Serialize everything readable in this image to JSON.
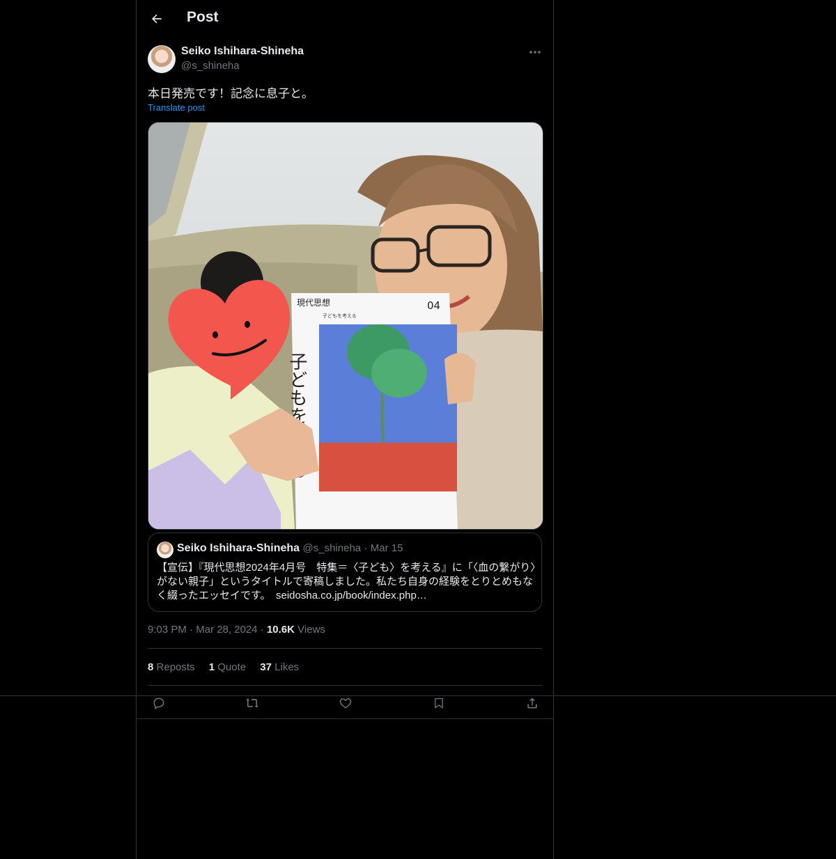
{
  "header": {
    "title": "Post",
    "back_icon": "arrow-left-icon"
  },
  "author": {
    "display_name": "Seiko Ishihara-Shineha",
    "handle": "@s_shineha"
  },
  "post": {
    "text": "本日発売です！記念に息子と。",
    "translate_label": "Translate post",
    "image": {
      "book_title_small": "現代思想",
      "book_issue": "04",
      "book_cover_vertical": "子どもを考える",
      "book_subtitle": "子どもを考える"
    }
  },
  "quoted_post": {
    "display_name": "Seiko Ishihara-Shineha",
    "handle": "@s_shineha",
    "date": "Mar 15",
    "text": "【宣伝】『現代思想2024年4月号　特集＝〈子ども〉を考える』に「〈血の繋がり〉がない親子」というタイトルで寄稿しました。私たち自身の経験をとりとめもなく綴ったエッセイです。　seidosha.co.jp/book/index.php…"
  },
  "meta": {
    "time": "9:03 PM",
    "date": "Mar 28, 2024",
    "views_count": "10.6K",
    "views_label": "Views"
  },
  "stats": {
    "reposts_count": "8",
    "reposts_label": "Reposts",
    "quotes_count": "1",
    "quotes_label": "Quote",
    "likes_count": "37",
    "likes_label": "Likes"
  },
  "colors": {
    "background": "#000000",
    "text": "#e7e9ea",
    "muted": "#71767b",
    "accent": "#1d9bf0",
    "border": "#2f3336"
  }
}
